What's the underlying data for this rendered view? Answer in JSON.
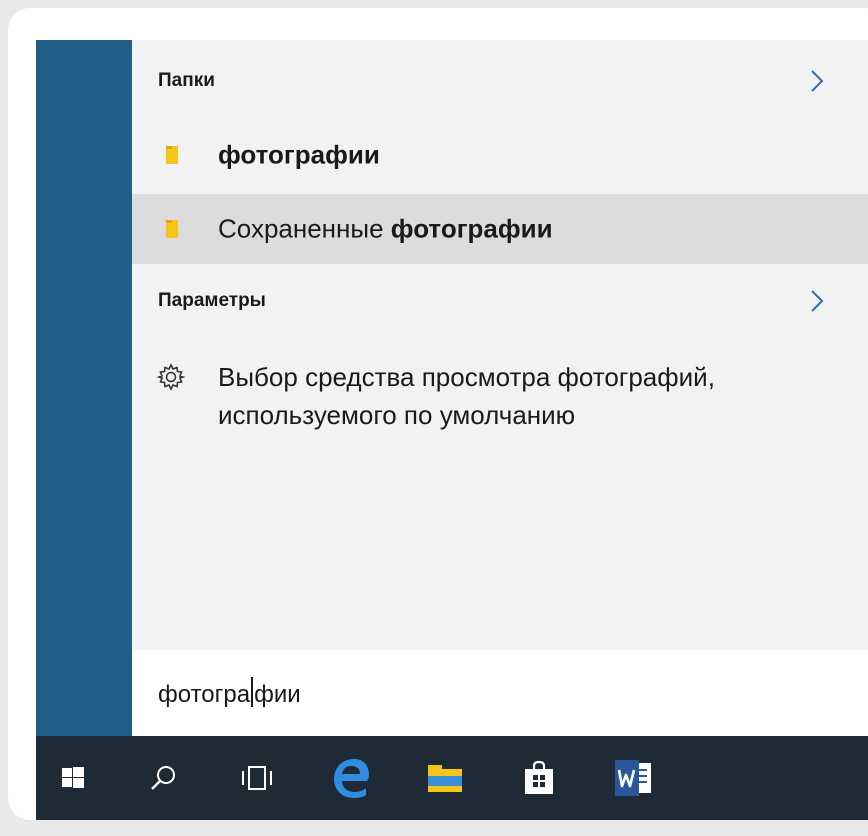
{
  "results": {
    "folders": {
      "header": "Папки",
      "items": [
        {
          "prefix": "",
          "match": "фотографии",
          "suffix": "",
          "selected": false
        },
        {
          "prefix": "Сохраненные ",
          "match": "фотографии",
          "suffix": "",
          "selected": true
        }
      ]
    },
    "settings": {
      "header": "Параметры",
      "items": [
        {
          "label": "Выбор средства просмотра фотографий, используемого по умолчанию",
          "icon": "gear-icon"
        }
      ]
    }
  },
  "search": {
    "query_before_caret": "фотогра",
    "query_after_caret": "фии"
  },
  "taskbar": {
    "buttons": [
      "windows-start-icon",
      "search-icon",
      "task-view-icon",
      "edge-icon",
      "file-explorer-icon",
      "store-icon",
      "word-icon"
    ]
  },
  "colors": {
    "accent_strip": "#1f5f87",
    "taskbar": "#1e2b37",
    "panel": "#f2f2f2",
    "selection": "#dcdcdc",
    "folder": "#f5c518",
    "chevron": "#2f6fb0"
  }
}
